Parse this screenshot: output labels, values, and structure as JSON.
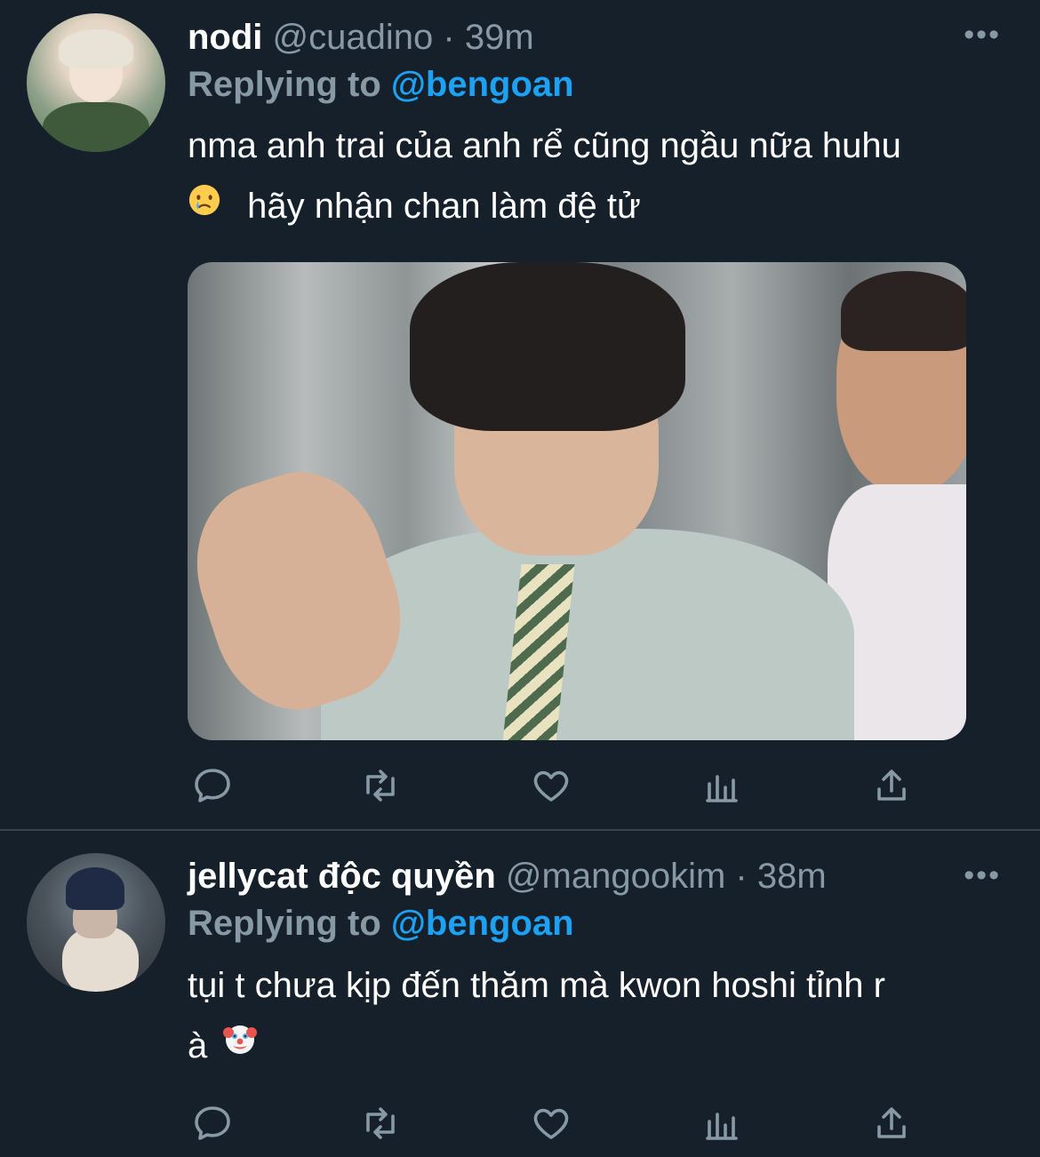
{
  "tweets": [
    {
      "name": "nodi",
      "handle": "@cuadino",
      "separator": "·",
      "time": "39m",
      "replying_prefix": "Replying to",
      "replying_to": "@bengoan",
      "text_line1": "nma anh trai của anh rể cũng ngầu nữa huhu",
      "text_line2": "hãy nhận chan làm đệ tử",
      "emoji": "crying-face",
      "more": "•••"
    },
    {
      "name": "jellycat độc quyền",
      "handle": "@mangookim",
      "separator": "·",
      "time": "38m",
      "replying_prefix": "Replying to",
      "replying_to": "@bengoan",
      "text_line1": "tụi t chưa kịp đến thăm mà kwon hoshi tỉnh r",
      "text_line2": "à",
      "emoji": "clown-face",
      "more": "•••"
    }
  ],
  "colors": {
    "background": "#15202b",
    "secondary_text": "#8899a6",
    "link": "#1da1f2",
    "divider": "#38444d"
  },
  "icons": [
    "reply-icon",
    "retweet-icon",
    "like-icon",
    "analytics-icon",
    "share-icon"
  ]
}
